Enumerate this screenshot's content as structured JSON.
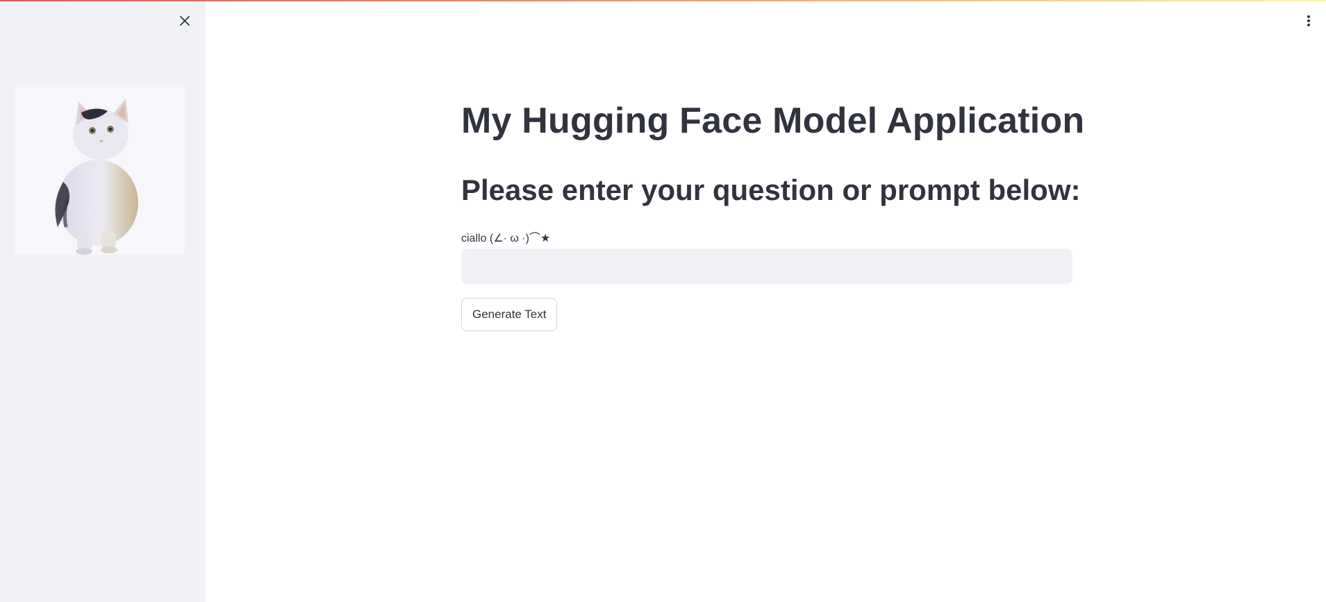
{
  "sidebar": {
    "image": {
      "icon": "cat-photo",
      "description_hidden": true
    },
    "close_icon": "close-icon"
  },
  "header": {
    "menu_icon": "vertical-dots-icon"
  },
  "main": {
    "title": "My Hugging Face Model Application",
    "subtitle": "Please enter your question or prompt below:",
    "input_label": "ciallo (∠· ω ·)⌒★",
    "input_value": "",
    "input_placeholder": "",
    "button_label": "Generate Text"
  },
  "colors": {
    "sidebar_bg": "#f0f2f6",
    "text": "#31333f",
    "input_bg": "#f0f2f6",
    "accent_gradient_start": "#ff4b4b",
    "accent_gradient_end": "#fffd80"
  }
}
